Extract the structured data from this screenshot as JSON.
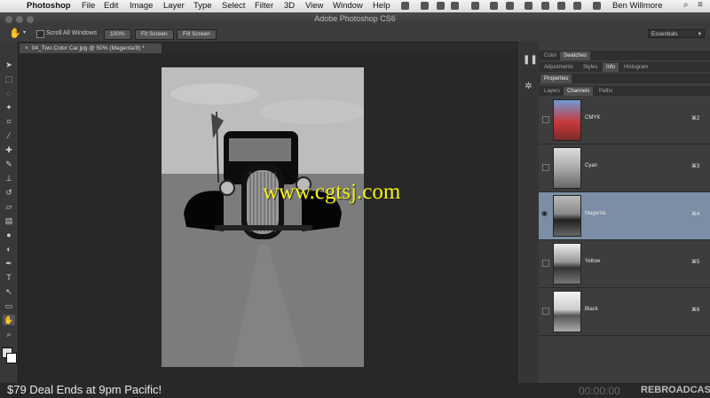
{
  "menubar": {
    "app_name": "Photoshop",
    "items": [
      "File",
      "Edit",
      "Image",
      "Layer",
      "Type",
      "Select",
      "Filter",
      "3D",
      "View",
      "Window",
      "Help"
    ],
    "user": "Ben Willmore"
  },
  "window": {
    "title": "Adobe Photoshop CS6"
  },
  "options_bar": {
    "scroll_all_label": "Scroll All Windows",
    "zoom_100_label": "100%",
    "fit_screen_label": "Fit Screen",
    "fill_screen_label": "Fill Screen",
    "workspace": "Essentials"
  },
  "document": {
    "tab_label": "04_Two Color Car.jpg @ 50% (Magenta/8) *"
  },
  "panels": {
    "top_tabs": [
      "Color",
      "Swatches"
    ],
    "mid_tabs": [
      "Adjustments",
      "Styles",
      "Info",
      "Histogram"
    ],
    "properties_label": "Properties",
    "bottom_tabs": [
      "Layers",
      "Channels",
      "Paths"
    ],
    "channels": [
      {
        "name": "CMYK",
        "shortcut": "⌘2"
      },
      {
        "name": "Cyan",
        "shortcut": "⌘3"
      },
      {
        "name": "Magenta",
        "shortcut": "⌘4"
      },
      {
        "name": "Yellow",
        "shortcut": "⌘5"
      },
      {
        "name": "Black",
        "shortcut": "⌘6"
      }
    ],
    "selected_channel": "Magenta"
  },
  "watermark": "www.cgtsj.com",
  "overlay": {
    "deal_text": "$79 Deal Ends at 9pm Pacific!",
    "timecode": "00:00:00",
    "brand": "REBROADCAST"
  },
  "colors": {
    "selection": "#7b8ea6",
    "watermark": "#f7f21a",
    "panel_bg": "#3d3d3d"
  }
}
